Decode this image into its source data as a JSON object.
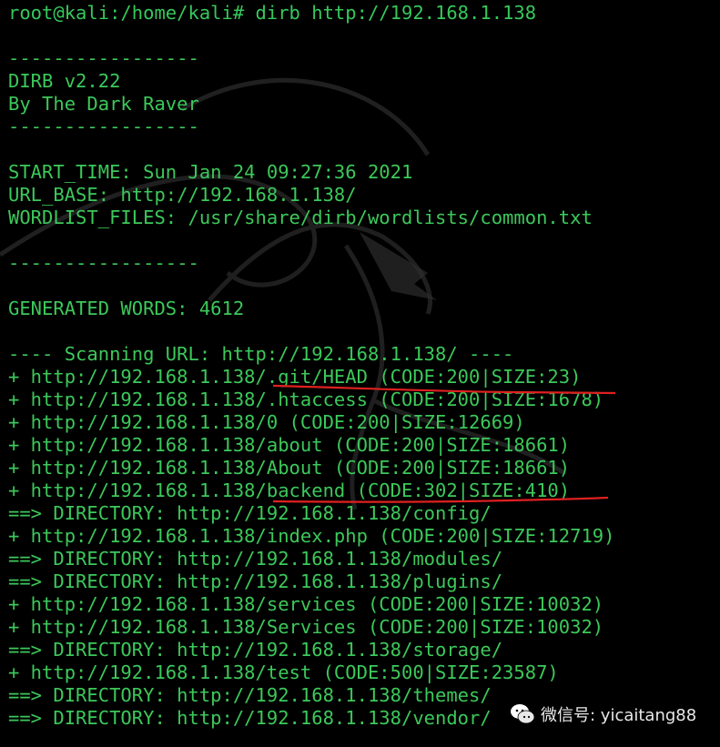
{
  "colors": {
    "background": "#000000",
    "text": "#3cc85a",
    "underline": "#e02020",
    "watermark": "#e8e8e8"
  },
  "terminal": {
    "lines": [
      "root@kali:/home/kali# dirb http://192.168.1.138",
      "",
      "-----------------",
      "DIRB v2.22",
      "By The Dark Raver",
      "-----------------",
      "",
      "START_TIME: Sun Jan 24 09:27:36 2021",
      "URL_BASE: http://192.168.1.138/",
      "WORDLIST_FILES: /usr/share/dirb/wordlists/common.txt",
      "",
      "-----------------",
      "",
      "GENERATED WORDS: 4612",
      "",
      "---- Scanning URL: http://192.168.1.138/ ----",
      "+ http://192.168.1.138/.git/HEAD (CODE:200|SIZE:23)",
      "+ http://192.168.1.138/.htaccess (CODE:200|SIZE:1678)",
      "+ http://192.168.1.138/0 (CODE:200|SIZE:12669)",
      "+ http://192.168.1.138/about (CODE:200|SIZE:18661)",
      "+ http://192.168.1.138/About (CODE:200|SIZE:18661)",
      "+ http://192.168.1.138/backend (CODE:302|SIZE:410)",
      "==> DIRECTORY: http://192.168.1.138/config/",
      "+ http://192.168.1.138/index.php (CODE:200|SIZE:12719)",
      "==> DIRECTORY: http://192.168.1.138/modules/",
      "==> DIRECTORY: http://192.168.1.138/plugins/",
      "+ http://192.168.1.138/services (CODE:200|SIZE:10032)",
      "+ http://192.168.1.138/Services (CODE:200|SIZE:10032)",
      "==> DIRECTORY: http://192.168.1.138/storage/",
      "+ http://192.168.1.138/test (CODE:500|SIZE:23587)",
      "==> DIRECTORY: http://192.168.1.138/themes/",
      "==> DIRECTORY: http://192.168.1.138/vendor/"
    ]
  },
  "watermark": {
    "text": "微信号: yicaitang88",
    "icon": "wechat-icon"
  },
  "background_logo": "kali-dragon-icon"
}
